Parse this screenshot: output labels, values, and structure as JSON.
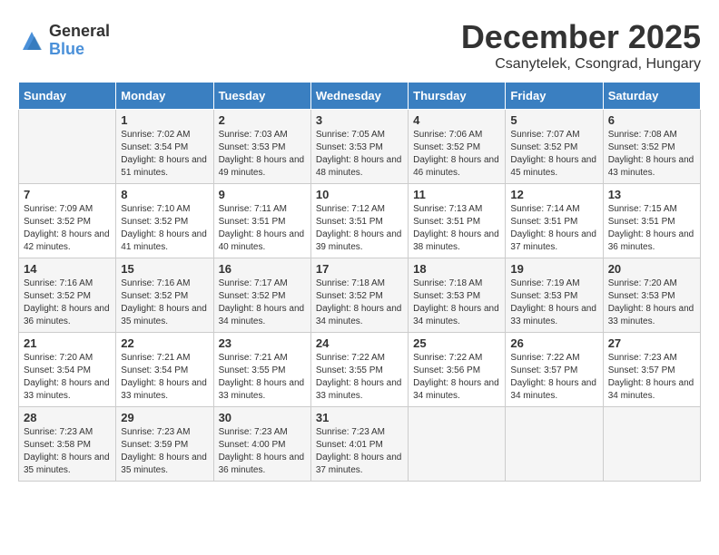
{
  "logo": {
    "general": "General",
    "blue": "Blue"
  },
  "header": {
    "month": "December 2025",
    "location": "Csanytelek, Csongrad, Hungary"
  },
  "days_of_week": [
    "Sunday",
    "Monday",
    "Tuesday",
    "Wednesday",
    "Thursday",
    "Friday",
    "Saturday"
  ],
  "weeks": [
    [
      {
        "day": "",
        "sunrise": "",
        "sunset": "",
        "daylight": ""
      },
      {
        "day": "1",
        "sunrise": "7:02 AM",
        "sunset": "3:54 PM",
        "daylight": "8 hours and 51 minutes."
      },
      {
        "day": "2",
        "sunrise": "7:03 AM",
        "sunset": "3:53 PM",
        "daylight": "8 hours and 49 minutes."
      },
      {
        "day": "3",
        "sunrise": "7:05 AM",
        "sunset": "3:53 PM",
        "daylight": "8 hours and 48 minutes."
      },
      {
        "day": "4",
        "sunrise": "7:06 AM",
        "sunset": "3:52 PM",
        "daylight": "8 hours and 46 minutes."
      },
      {
        "day": "5",
        "sunrise": "7:07 AM",
        "sunset": "3:52 PM",
        "daylight": "8 hours and 45 minutes."
      },
      {
        "day": "6",
        "sunrise": "7:08 AM",
        "sunset": "3:52 PM",
        "daylight": "8 hours and 43 minutes."
      }
    ],
    [
      {
        "day": "7",
        "sunrise": "7:09 AM",
        "sunset": "3:52 PM",
        "daylight": "8 hours and 42 minutes."
      },
      {
        "day": "8",
        "sunrise": "7:10 AM",
        "sunset": "3:52 PM",
        "daylight": "8 hours and 41 minutes."
      },
      {
        "day": "9",
        "sunrise": "7:11 AM",
        "sunset": "3:51 PM",
        "daylight": "8 hours and 40 minutes."
      },
      {
        "day": "10",
        "sunrise": "7:12 AM",
        "sunset": "3:51 PM",
        "daylight": "8 hours and 39 minutes."
      },
      {
        "day": "11",
        "sunrise": "7:13 AM",
        "sunset": "3:51 PM",
        "daylight": "8 hours and 38 minutes."
      },
      {
        "day": "12",
        "sunrise": "7:14 AM",
        "sunset": "3:51 PM",
        "daylight": "8 hours and 37 minutes."
      },
      {
        "day": "13",
        "sunrise": "7:15 AM",
        "sunset": "3:51 PM",
        "daylight": "8 hours and 36 minutes."
      }
    ],
    [
      {
        "day": "14",
        "sunrise": "7:16 AM",
        "sunset": "3:52 PM",
        "daylight": "8 hours and 36 minutes."
      },
      {
        "day": "15",
        "sunrise": "7:16 AM",
        "sunset": "3:52 PM",
        "daylight": "8 hours and 35 minutes."
      },
      {
        "day": "16",
        "sunrise": "7:17 AM",
        "sunset": "3:52 PM",
        "daylight": "8 hours and 34 minutes."
      },
      {
        "day": "17",
        "sunrise": "7:18 AM",
        "sunset": "3:52 PM",
        "daylight": "8 hours and 34 minutes."
      },
      {
        "day": "18",
        "sunrise": "7:18 AM",
        "sunset": "3:53 PM",
        "daylight": "8 hours and 34 minutes."
      },
      {
        "day": "19",
        "sunrise": "7:19 AM",
        "sunset": "3:53 PM",
        "daylight": "8 hours and 33 minutes."
      },
      {
        "day": "20",
        "sunrise": "7:20 AM",
        "sunset": "3:53 PM",
        "daylight": "8 hours and 33 minutes."
      }
    ],
    [
      {
        "day": "21",
        "sunrise": "7:20 AM",
        "sunset": "3:54 PM",
        "daylight": "8 hours and 33 minutes."
      },
      {
        "day": "22",
        "sunrise": "7:21 AM",
        "sunset": "3:54 PM",
        "daylight": "8 hours and 33 minutes."
      },
      {
        "day": "23",
        "sunrise": "7:21 AM",
        "sunset": "3:55 PM",
        "daylight": "8 hours and 33 minutes."
      },
      {
        "day": "24",
        "sunrise": "7:22 AM",
        "sunset": "3:55 PM",
        "daylight": "8 hours and 33 minutes."
      },
      {
        "day": "25",
        "sunrise": "7:22 AM",
        "sunset": "3:56 PM",
        "daylight": "8 hours and 34 minutes."
      },
      {
        "day": "26",
        "sunrise": "7:22 AM",
        "sunset": "3:57 PM",
        "daylight": "8 hours and 34 minutes."
      },
      {
        "day": "27",
        "sunrise": "7:23 AM",
        "sunset": "3:57 PM",
        "daylight": "8 hours and 34 minutes."
      }
    ],
    [
      {
        "day": "28",
        "sunrise": "7:23 AM",
        "sunset": "3:58 PM",
        "daylight": "8 hours and 35 minutes."
      },
      {
        "day": "29",
        "sunrise": "7:23 AM",
        "sunset": "3:59 PM",
        "daylight": "8 hours and 35 minutes."
      },
      {
        "day": "30",
        "sunrise": "7:23 AM",
        "sunset": "4:00 PM",
        "daylight": "8 hours and 36 minutes."
      },
      {
        "day": "31",
        "sunrise": "7:23 AM",
        "sunset": "4:01 PM",
        "daylight": "8 hours and 37 minutes."
      },
      {
        "day": "",
        "sunrise": "",
        "sunset": "",
        "daylight": ""
      },
      {
        "day": "",
        "sunrise": "",
        "sunset": "",
        "daylight": ""
      },
      {
        "day": "",
        "sunrise": "",
        "sunset": "",
        "daylight": ""
      }
    ]
  ]
}
